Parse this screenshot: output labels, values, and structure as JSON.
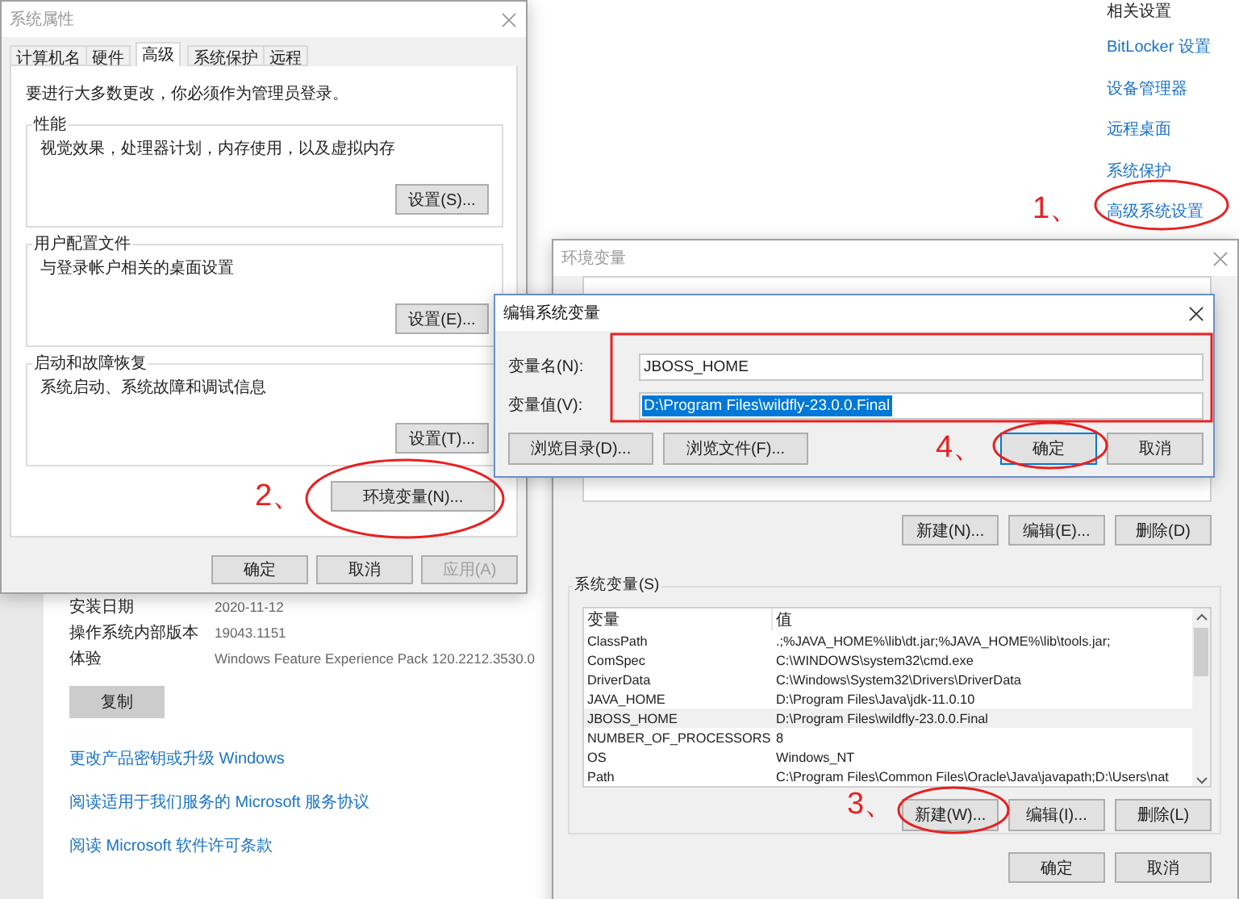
{
  "settings_page": {
    "related_title": "相关设置",
    "related_links": [
      "BitLocker 设置",
      "设备管理器",
      "远程桌面",
      "系统保护",
      "高级系统设置"
    ],
    "info_rows": [
      {
        "label": "安装日期",
        "value": "2020-11-12"
      },
      {
        "label": "操作系统内部版本",
        "value": "19043.1151"
      },
      {
        "label": "体验",
        "value": "Windows Feature Experience Pack 120.2212.3530.0"
      }
    ],
    "copy_button": "复制",
    "links": [
      "更改产品密钥或升级 Windows",
      "阅读适用于我们服务的 Microsoft 服务协议",
      "阅读 Microsoft 软件许可条款"
    ]
  },
  "system_properties": {
    "title": "系统属性",
    "tabs": [
      {
        "label": "计算机名",
        "selected": false
      },
      {
        "label": "硬件",
        "selected": false
      },
      {
        "label": "高级",
        "selected": true
      },
      {
        "label": "系统保护",
        "selected": false
      },
      {
        "label": "远程",
        "selected": false
      }
    ],
    "notice": "要进行大多数更改，你必须作为管理员登录。",
    "groups": [
      {
        "title": "性能",
        "description": "视觉效果，处理器计划，内存使用，以及虚拟内存",
        "button": "设置(S)..."
      },
      {
        "title": "用户配置文件",
        "description": "与登录帐户相关的桌面设置",
        "button": "设置(E)..."
      },
      {
        "title": "启动和故障恢复",
        "description": "系统启动、系统故障和调试信息",
        "button": "设置(T)..."
      }
    ],
    "env_button": "环境变量(N)...",
    "footer_buttons": [
      {
        "label": "确定",
        "disabled": false
      },
      {
        "label": "取消",
        "disabled": false
      },
      {
        "label": "应用(A)",
        "disabled": true
      }
    ]
  },
  "environment_variables": {
    "title": "环境变量",
    "user_buttons": [
      "新建(N)...",
      "编辑(E)...",
      "删除(D)"
    ],
    "system_group": "系统变量(S)",
    "columns": [
      "变量",
      "值"
    ],
    "rows": [
      {
        "name": "ClassPath",
        "value": ".;%JAVA_HOME%\\lib\\dt.jar;%JAVA_HOME%\\lib\\tools.jar;",
        "selected": false
      },
      {
        "name": "ComSpec",
        "value": "C:\\WINDOWS\\system32\\cmd.exe",
        "selected": false
      },
      {
        "name": "DriverData",
        "value": "C:\\Windows\\System32\\Drivers\\DriverData",
        "selected": false
      },
      {
        "name": "JAVA_HOME",
        "value": "D:\\Program Files\\Java\\jdk-11.0.10",
        "selected": false
      },
      {
        "name": "JBOSS_HOME",
        "value": "D:\\Program Files\\wildfly-23.0.0.Final",
        "selected": true
      },
      {
        "name": "NUMBER_OF_PROCESSORS",
        "value": "8",
        "selected": false
      },
      {
        "name": "OS",
        "value": "Windows_NT",
        "selected": false
      },
      {
        "name": "Path",
        "value": "C:\\Program Files\\Common Files\\Oracle\\Java\\javapath;D:\\Users\\nat",
        "selected": false
      }
    ],
    "system_buttons": [
      "新建(W)...",
      "编辑(I)...",
      "删除(L)"
    ],
    "footer_buttons": [
      "确定",
      "取消"
    ]
  },
  "edit_dialog": {
    "title": "编辑系统变量",
    "fields": [
      {
        "label": "变量名(N):",
        "value": "JBOSS_HOME",
        "selected": false
      },
      {
        "label": "变量值(V):",
        "value": "D:\\Program Files\\wildfly-23.0.0.Final",
        "selected": true
      }
    ],
    "browse_buttons": [
      "浏览目录(D)...",
      "浏览文件(F)..."
    ],
    "action_buttons": [
      "确定",
      "取消"
    ]
  },
  "annotations": [
    "1、",
    "2、",
    "3、",
    "4、"
  ]
}
